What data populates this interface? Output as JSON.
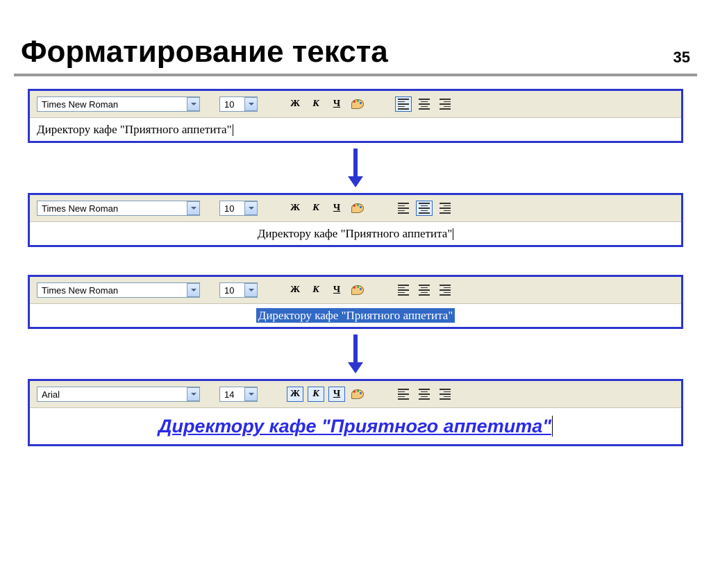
{
  "page": {
    "number": "35",
    "title": "Форматирование текста"
  },
  "panels": [
    {
      "font": "Times New Roman",
      "size": "10",
      "text": "Директору кафе \"Приятного аппетита\"",
      "align_active": "left",
      "text_align": "left",
      "selected": false,
      "bold_active": false,
      "italic_active": false,
      "underline_active": false,
      "large": false
    },
    {
      "font": "Times New Roman",
      "size": "10",
      "text": "Директору кафе \"Приятного аппетита\"",
      "align_active": "center",
      "text_align": "center",
      "selected": false,
      "bold_active": false,
      "italic_active": false,
      "underline_active": false,
      "large": false
    },
    {
      "font": "Times New Roman",
      "size": "10",
      "text": "Директору кафе \"Приятного аппетита\"",
      "align_active": "none",
      "text_align": "center",
      "selected": true,
      "bold_active": false,
      "italic_active": false,
      "underline_active": false,
      "large": false
    },
    {
      "font": "Arial",
      "size": "14",
      "text": "Директору кафе \"Приятного аппетита\"",
      "align_active": "none",
      "text_align": "center",
      "selected": false,
      "bold_active": true,
      "italic_active": true,
      "underline_active": true,
      "large": true
    }
  ],
  "buttons": {
    "bold": "Ж",
    "italic": "К",
    "underline": "Ч"
  }
}
